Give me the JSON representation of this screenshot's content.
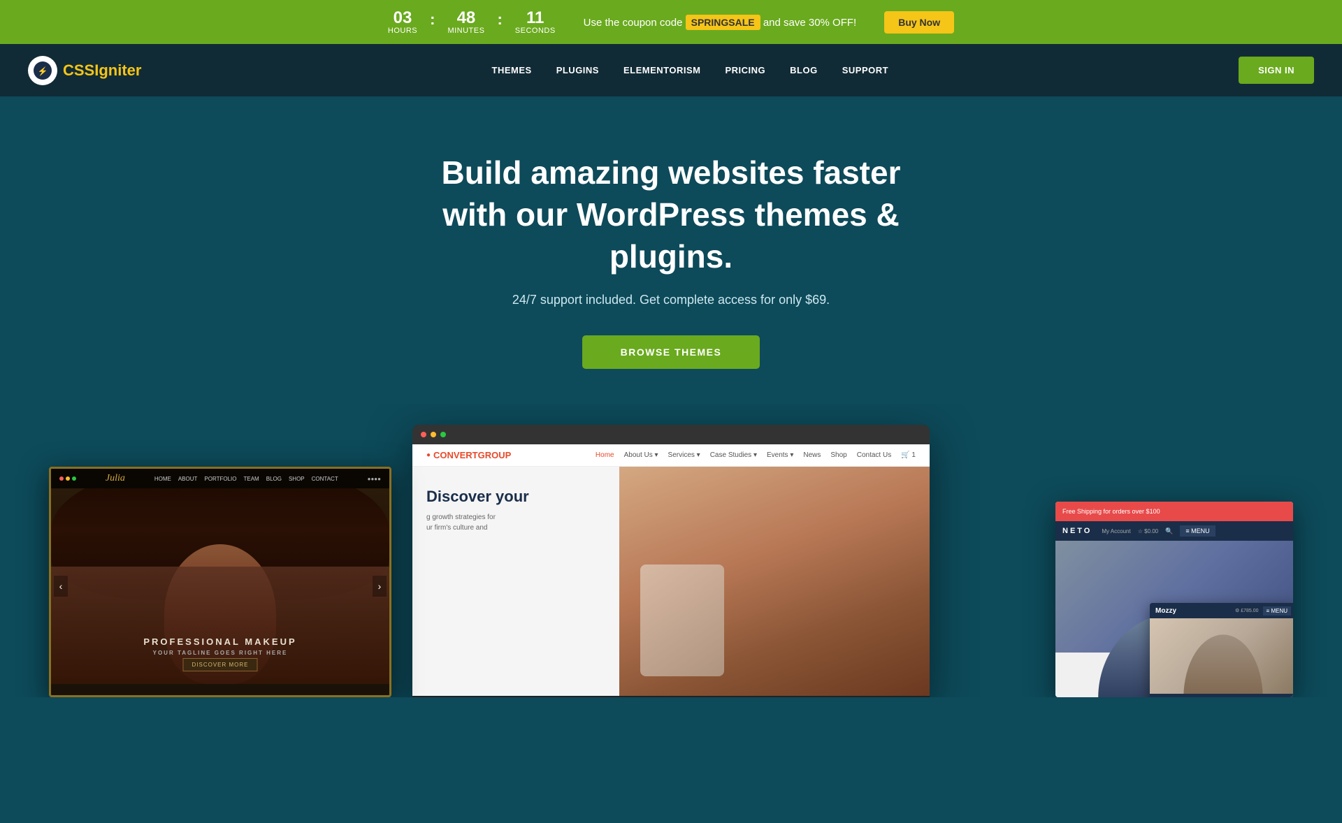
{
  "topBanner": {
    "countdown": {
      "hours": {
        "number": "03",
        "label": "Hours"
      },
      "minutes": {
        "number": "48",
        "label": "Minutes"
      },
      "seconds": {
        "number": "11",
        "label": "Seconds"
      }
    },
    "promoText": "Use the coupon code",
    "couponCode": "SPRINGSALE",
    "promoSuffix": "and save 30% OFF!",
    "buyNowLabel": "Buy Now"
  },
  "header": {
    "logoTextBold": "CSS",
    "logoTextLight": "Igniter",
    "nav": [
      {
        "label": "THEMES",
        "id": "themes"
      },
      {
        "label": "PLUGINS",
        "id": "plugins"
      },
      {
        "label": "ELEMENTORISM",
        "id": "elementorism"
      },
      {
        "label": "PRICING",
        "id": "pricing"
      },
      {
        "label": "BLOG",
        "id": "blog"
      },
      {
        "label": "SUPPORT",
        "id": "support"
      }
    ],
    "signInLabel": "SIGN IN"
  },
  "hero": {
    "title": "Build amazing websites faster\nwith our WordPress themes & plugins.",
    "subtitle": "24/7 support included. Get complete access for only $69.",
    "browseLabel": "BROWSE THEMES"
  },
  "showcase": {
    "convertGroup": {
      "logo": "CONVERTGROUP",
      "navItems": [
        "Home",
        "About Us",
        "Services",
        "Case Studies",
        "Events",
        "News",
        "Shop",
        "Contact Us",
        "🛒 1"
      ],
      "heading": "Discover your",
      "body": "g growth strategies for\nur firm's culture and"
    },
    "makeup": {
      "logo": "Julia",
      "navItems": [
        "HOME",
        "ABOUT",
        "PORTFOLIO",
        "BLOG",
        "TEAM",
        "BLOG",
        "SHOP",
        "CONTACT"
      ],
      "heading": "PROFESSIONAL MAKEUP",
      "btnLabel": "DISCOVER MORE",
      "dots": "●●●●"
    },
    "neto": {
      "bannerText": "Free Shipping for orders over $100",
      "logo": "NETO",
      "navItems": [
        "My Account",
        "$0.00",
        "🔍"
      ],
      "menuLabel": "≡ MENU"
    },
    "mozzy": {
      "logo": "Mozzy",
      "navItems": [
        "⚙ £785.00"
      ],
      "menuLabel": "≡ MENU"
    }
  },
  "colors": {
    "greenAccent": "#6aaa1e",
    "darkBg": "#0d4a5a",
    "headerBg": "#112b36",
    "yellow": "#f5c518"
  }
}
